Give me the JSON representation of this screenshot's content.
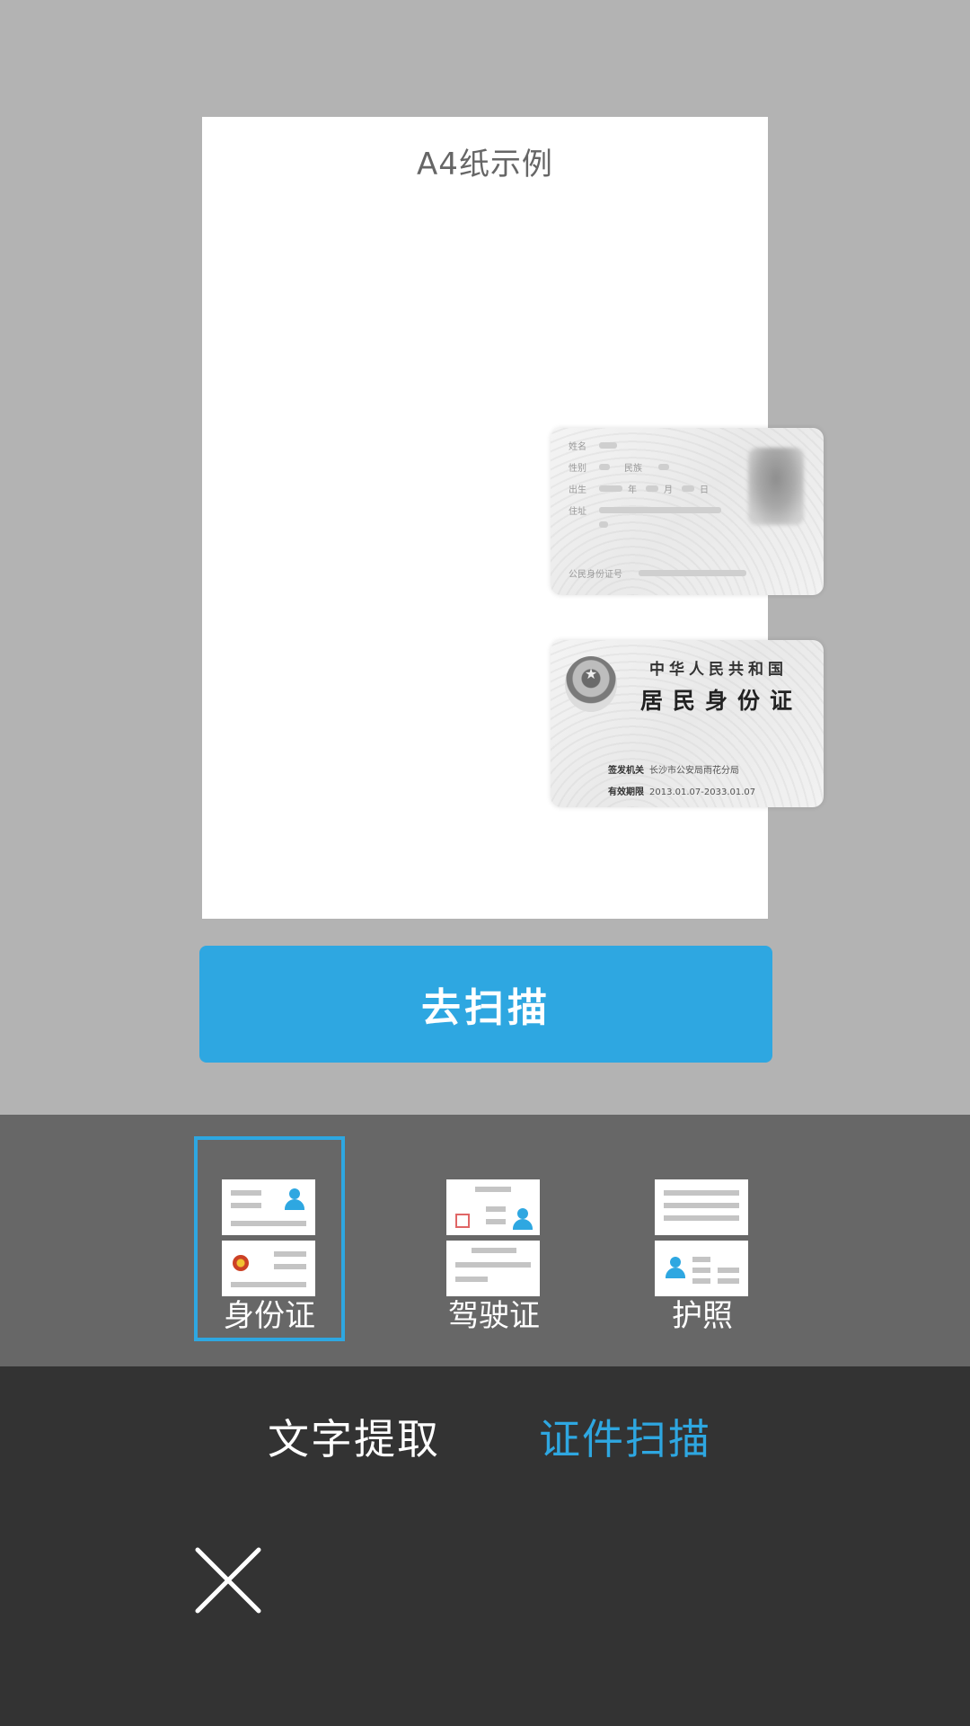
{
  "preview": {
    "sheet_title": "A4纸示例",
    "card_front": {
      "fields": [
        "姓名",
        "性别",
        "民族",
        "出生",
        "年",
        "月",
        "日",
        "住址",
        "公民身份证号"
      ]
    },
    "card_back": {
      "country": "中华人民共和国",
      "title": "居民身份证",
      "issuer_label": "签发机关",
      "issuer_value": "长沙市公安局雨花分局",
      "validity_label": "有效期限",
      "validity_value": "2013.01.07-2033.01.07"
    }
  },
  "scan_button": {
    "label": "去扫描"
  },
  "doc_types": [
    {
      "label": "身份证",
      "selected": true
    },
    {
      "label": "驾驶证",
      "selected": false
    },
    {
      "label": "护照",
      "selected": false
    }
  ],
  "mode_tabs": [
    {
      "label": "文字提取",
      "active": false
    },
    {
      "label": "证件扫描",
      "active": true
    }
  ],
  "colors": {
    "accent": "#2ea7e1",
    "preview_bg": "#b3b3b3",
    "type_bar_bg": "#676767",
    "mode_bar_bg": "#333333"
  },
  "icons": {
    "close": "close-icon"
  }
}
